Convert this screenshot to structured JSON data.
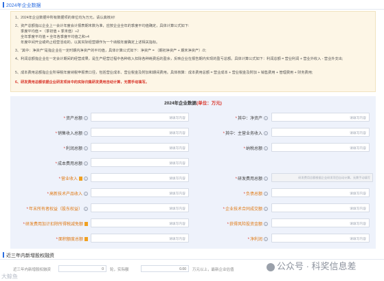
{
  "header": {
    "title": "2024年企业数据"
  },
  "notice": {
    "lines": [
      "1、2024年企业数据中所有数据项的单位均为万元，请认真核对!",
      "2、资产总额指以企业上一会计年度会计报表期末数为准，应按企业全年的季度平均值确定，具体计算公式如下:",
      "季度平均值 = （季初值 + 季末值）÷2",
      "全年季度平均值 = 全年各季度平均值之和÷4",
      "年度中间开业或终止经营活动的，以其实际经营期作为一个纳税年度确定上述相关指标。",
      "3、“其中：净资产”是指企业在一定时期内净资产的平均值，具体计算公式如下：净资产 = （期初净资产 + 期末净资产）/2;",
      "4、利润总额指企业在一定会计期间的经营成果，是生产经营过程中各种收入扣除各种耗费后的盈余，反映企业在报告期内实现的盈亏总额。具体计算公式如下：利润总额 = 营业利润 + 营业外收入 - 营业外支出;",
      "5、成本费用总额指企业所得税年度纳税申报表口径，包括营业成本、营业税金及附加和期间费用。具体核算：成本费用总额 = 营业成本 + 营业税金及附加 + 销售费用 + 管理费用 + 财务费用;",
      "6、研发费用总额依据企业研发项目中的实际归集研发费用自动计算，无需手动填写。"
    ]
  },
  "form": {
    "title": "2024年企业数据",
    "unit": "(单位：万元)",
    "placeholder": "请填写内容",
    "auto_placeholder": "研发费用总额根据企业研发项目自动计算，无需手动填写",
    "fields": [
      {
        "label": "资产总额"
      },
      {
        "label": "其中：净资产"
      },
      {
        "label": "销售收入总额"
      },
      {
        "label": "其中：主营业务收入"
      },
      {
        "label": "利润总额"
      },
      {
        "label": "纳税总额"
      },
      {
        "label": "成本费用总额"
      },
      {
        "label": "营业收入"
      },
      {
        "label": "研发费用总额"
      },
      {
        "label": "高新技术产品收入"
      },
      {
        "label": "负债总额"
      },
      {
        "label": "年末所有者权益（股东权益）"
      },
      {
        "label": "企业技术合同成交额"
      },
      {
        "label": "研发费用加计扣除所得税减免额"
      },
      {
        "label": "获得风险投资金额"
      },
      {
        "label": "面积额度总额"
      },
      {
        "label": "净利润"
      }
    ]
  },
  "section2": {
    "title": "近三年内新增股权融资",
    "row_label": "近三年内新增股权融资",
    "value1": "0",
    "unit1": "轮，实际额",
    "value2": "0.00",
    "unit2": "万元以上，最新企业估值"
  },
  "watermarks": {
    "left": "大鲸鱼",
    "right": "公众号 · 科奖信息差"
  }
}
